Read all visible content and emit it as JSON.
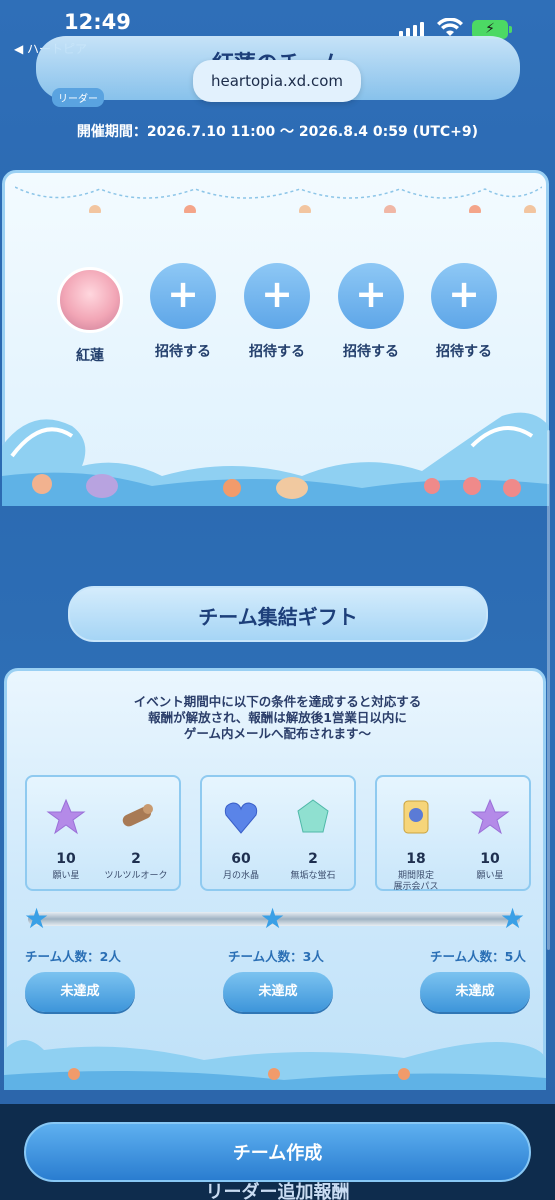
{
  "status_bar": {
    "time": "12:49",
    "battery_icon": "charging-battery-icon"
  },
  "nav": {
    "back_label": "◀ ハートピア"
  },
  "header": {
    "title": "紅蓮のチーム",
    "url": "heartopia.xd.com",
    "period": "開催期間：2026.7.10 11:00 〜 2026.8.4 0:59 (UTC+9)"
  },
  "team": {
    "leader_tag": "リーダー",
    "members": [
      {
        "label": "紅蓮",
        "type": "avatar"
      },
      {
        "label": "招待する",
        "type": "invite",
        "icon": "plus-icon"
      },
      {
        "label": "招待する",
        "type": "invite",
        "icon": "plus-icon"
      },
      {
        "label": "招待する",
        "type": "invite",
        "icon": "plus-icon"
      },
      {
        "label": "招待する",
        "type": "invite",
        "icon": "plus-icon"
      }
    ]
  },
  "gift": {
    "title": "チーム集結ギフト",
    "desc_line1": "イベント期間中に以下の条件を達成すると対応する",
    "desc_line2": "報酬が解放され、報酬は解放後1営業日以内に",
    "desc_line3": "ゲーム内メールへ配布されます〜",
    "tiers": [
      {
        "count_label": "チーム人数：2人",
        "button_label": "未達成",
        "rewards": [
          {
            "qty": "10",
            "name": "願い星",
            "icon": "purple-star-icon"
          },
          {
            "qty": "2",
            "name": "ツルツルオーク",
            "icon": "wood-log-icon"
          }
        ]
      },
      {
        "count_label": "チーム人数：3人",
        "button_label": "未達成",
        "rewards": [
          {
            "qty": "60",
            "name": "月の水晶",
            "icon": "blue-heart-crystal-icon"
          },
          {
            "qty": "2",
            "name": "無垢な蛍石",
            "icon": "green-gem-icon"
          }
        ]
      },
      {
        "count_label": "チーム人数：5人",
        "button_label": "未達成",
        "rewards": [
          {
            "qty": "18",
            "name_line1": "期間限定",
            "name_line2": "展示会パス",
            "icon": "pass-badge-icon"
          },
          {
            "qty": "10",
            "name": "願い星",
            "icon": "purple-star-icon"
          }
        ]
      }
    ]
  },
  "footer": {
    "create_button": "チーム作成",
    "next_section_title": "リーダー追加報酬"
  },
  "colors": {
    "accent": "#3d95da",
    "panel": "#def1fd",
    "background": "#2f6fb8"
  }
}
